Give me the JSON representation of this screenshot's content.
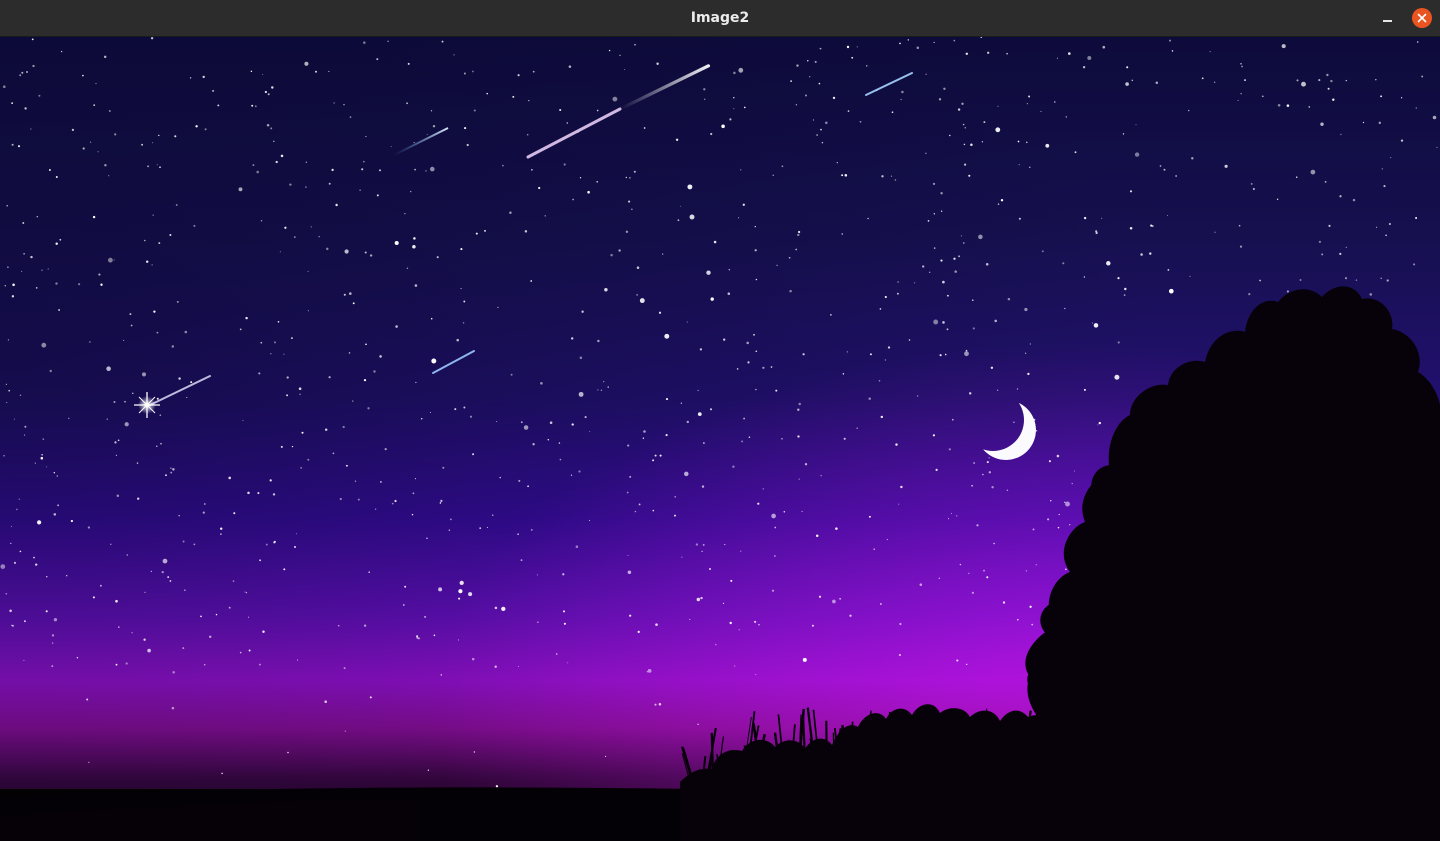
{
  "window": {
    "title": "Image2",
    "close_color": "#e95420"
  },
  "icons": {
    "minimize": "minimize-icon",
    "close": "close-icon"
  },
  "image": {
    "sky_colors": [
      "#0d0b3b",
      "#1a0f5c",
      "#3a0ba3",
      "#6c0fc7",
      "#b312d9",
      "#6a0a78",
      "#0a0208"
    ]
  }
}
